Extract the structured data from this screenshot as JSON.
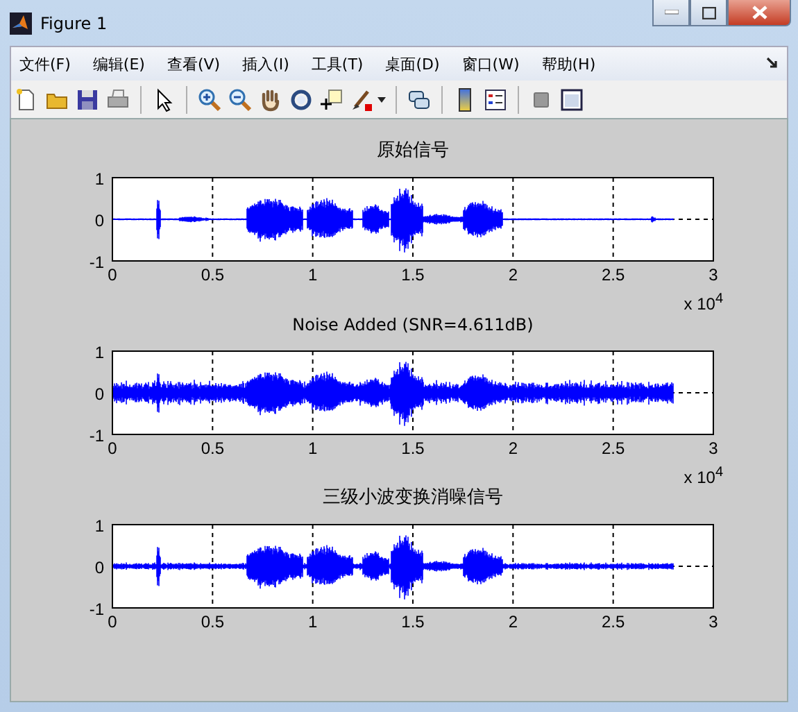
{
  "window": {
    "title": "Figure 1"
  },
  "menu": [
    "文件(F)",
    "编辑(E)",
    "查看(V)",
    "插入(I)",
    "工具(T)",
    "桌面(D)",
    "窗口(W)",
    "帮助(H)"
  ],
  "plots": [
    {
      "title": "原始信号",
      "kind": "clean",
      "yticks": [
        "1",
        "0",
        "-1"
      ],
      "xticks": [
        "0",
        "0.5",
        "1",
        "1.5",
        "2",
        "2.5",
        "3"
      ],
      "x_scale": "x 10$^{4}$"
    },
    {
      "title": "Noise Added (SNR=4.611dB)",
      "kind": "noisy",
      "yticks": [
        "1",
        "0",
        "-1"
      ],
      "xticks": [
        "0",
        "0.5",
        "1",
        "1.5",
        "2",
        "2.5",
        "3"
      ],
      "x_scale": "x 10$^{4}$"
    },
    {
      "title": "三级小波变换消噪信号",
      "kind": "denoised",
      "yticks": [
        "1",
        "0",
        "-1"
      ],
      "xticks": [
        "0",
        "0.5",
        "1",
        "1.5",
        "2",
        "2.5",
        "3"
      ]
    }
  ]
}
